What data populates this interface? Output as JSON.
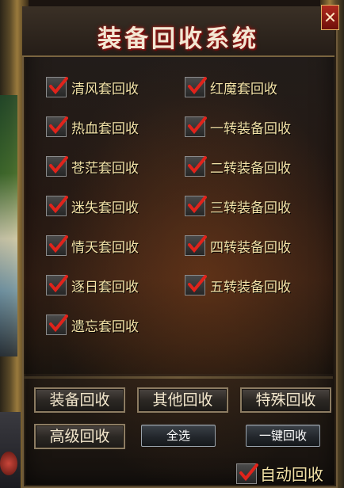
{
  "window": {
    "title": "装备回收系统",
    "close_label": "✕"
  },
  "options": [
    {
      "label": "清风套回收",
      "checked": true
    },
    {
      "label": "红魔套回收",
      "checked": true
    },
    {
      "label": "热血套回收",
      "checked": true
    },
    {
      "label": "一转装备回收",
      "checked": true
    },
    {
      "label": "苍茫套回收",
      "checked": true
    },
    {
      "label": "二转装备回收",
      "checked": true
    },
    {
      "label": "迷失套回收",
      "checked": true
    },
    {
      "label": "三转装备回收",
      "checked": true
    },
    {
      "label": "情天套回收",
      "checked": true
    },
    {
      "label": "四转装备回收",
      "checked": true
    },
    {
      "label": "逐日套回收",
      "checked": true
    },
    {
      "label": "五转装备回收",
      "checked": true
    },
    {
      "label": "遗忘套回收",
      "checked": true
    }
  ],
  "buttons": {
    "equip_recycle": "装备回收",
    "other_recycle": "其他回收",
    "special_recycle": "特殊回收",
    "advanced_recycle": "高级回收",
    "select_all": "全选",
    "one_key_recycle": "一键回收"
  },
  "auto_recycle": {
    "label": "自动回收",
    "checked": true
  },
  "colors": {
    "check_mark": "#e0231b",
    "option_text": "#f4e3a8",
    "title_glow": "#b0201a"
  }
}
